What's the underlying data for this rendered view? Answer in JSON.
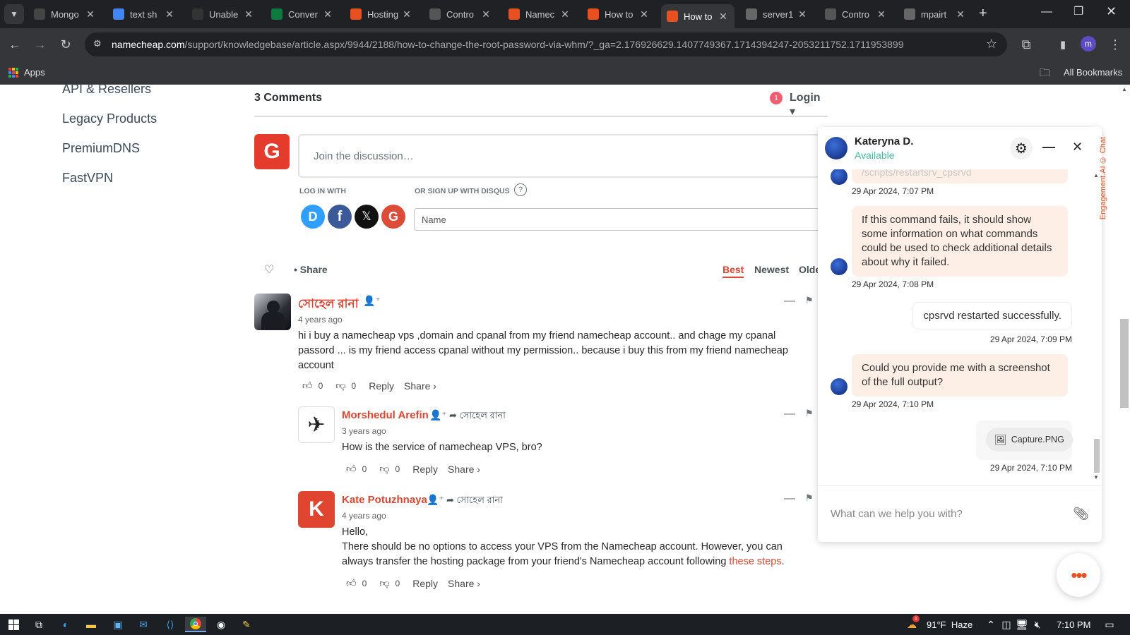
{
  "browser": {
    "tabs": [
      {
        "title": "Mongo",
        "icon": "openai-icon",
        "color": "#444"
      },
      {
        "title": "text sh",
        "icon": "docs-icon",
        "color": "#4285f4"
      },
      {
        "title": "Unable",
        "icon": "github-icon",
        "color": "#333"
      },
      {
        "title": "Conver",
        "icon": "mongodb-leaf-icon",
        "color": "#0d7a3e"
      },
      {
        "title": "Hosting",
        "icon": "namecheap-icon",
        "color": "#e8501f"
      },
      {
        "title": "Contro",
        "icon": "cpanel-icon",
        "color": "#555"
      },
      {
        "title": "Namec",
        "icon": "namecheap-icon",
        "color": "#e8501f"
      },
      {
        "title": "How to",
        "icon": "namecheap-icon",
        "color": "#e8501f"
      },
      {
        "title": "How to",
        "icon": "namecheap-icon",
        "color": "#e8501f",
        "active": true
      },
      {
        "title": "server1",
        "icon": "globe-icon",
        "color": "#666"
      },
      {
        "title": "Contro",
        "icon": "cpanel-icon",
        "color": "#555"
      },
      {
        "title": "mpairt",
        "icon": "globe-icon",
        "color": "#666"
      }
    ],
    "url_host": "namecheap.com",
    "url_path": "/support/knowledgebase/article.aspx/9944/2188/how-to-change-the-root-password-via-whm/?_ga=2.176926629.1407749367.1714394247-2053211752.1711953899",
    "bookmarks": {
      "apps_label": "Apps",
      "all_bookmarks_label": "All Bookmarks"
    },
    "profile_initial": "m"
  },
  "sidebar": {
    "links": [
      "API & Resellers",
      "Legacy Products",
      "PremiumDNS",
      "FastVPN"
    ]
  },
  "disqus": {
    "comments_count": "3 Comments",
    "notification_count": "1",
    "login_label": "Login",
    "user_avatar_letter": "G",
    "join_placeholder": "Join the discussion…",
    "log_in_with": "LOG IN WITH",
    "or_sign_up": "OR SIGN UP WITH DISQUS",
    "help_glyph": "?",
    "name_placeholder": "Name",
    "social": {
      "disqus": "D",
      "facebook": "f",
      "x": "𝕏",
      "google": "G"
    },
    "share_label": "Share",
    "sort": {
      "best": "Best",
      "newest": "Newest",
      "oldest": "Olde"
    },
    "comments": [
      {
        "author": "সোহেল রানা",
        "time": "4 years ago",
        "text": "hi i buy a namecheap vps ,domain and cpanal from my friend namecheap account.. and chage my cpanal passord ... is my friend access cpanal without my permission.. because i buy this from my friend namecheap account",
        "likes": "0",
        "dislikes": "0",
        "reply_label": "Reply",
        "share_label": "Share ›"
      },
      {
        "author": "Morshedul Arefin",
        "reply_to": "সোহেল রানা",
        "time": "3 years ago",
        "text": "How is the service of namecheap VPS, bro?",
        "likes": "0",
        "dislikes": "0",
        "reply_label": "Reply",
        "share_label": "Share ›"
      },
      {
        "author": "Kate Potuzhnaya",
        "avatar_letter": "K",
        "reply_to": "সোহেল রানা",
        "time": "4 years ago",
        "text_line1": "Hello,",
        "text_line2": "There should be no options to access your VPS from the Namecheap account. However, you can always transfer the hosting package from your friend's Namecheap account following ",
        "link_text": "these steps",
        "text_end": ".",
        "likes": "0",
        "dislikes": "0",
        "reply_label": "Reply",
        "share_label": "Share ›"
      }
    ]
  },
  "chat": {
    "agent_name": "Kateryna D.",
    "agent_status": "Available",
    "partial_message": "/scripts/restartsrv_cpsrvd",
    "messages": [
      {
        "from": "agent",
        "time": "29 Apr 2024, 7:07 PM"
      },
      {
        "from": "agent",
        "text": "If this command fails, it should show some information on what commands could be used to check additional details about why it failed.",
        "time": "29 Apr 2024, 7:08 PM"
      },
      {
        "from": "user",
        "text": "cpsrvd restarted successfully.",
        "time": "29 Apr 2024, 7:09 PM"
      },
      {
        "from": "agent",
        "text": "Could you provide me with a screenshot of the full output?",
        "time": "29 Apr 2024, 7:10 PM"
      },
      {
        "from": "user",
        "attachment": "Capture.PNG",
        "time": "29 Apr 2024, 7:10 PM"
      }
    ],
    "input_placeholder": "What can we help you with?",
    "side_label": "Engagement.AI © Chat",
    "accent": "#e8501f",
    "status_color": "#3cbf9e"
  },
  "taskbar": {
    "weather": "91°F  Haze",
    "weather_badge": "1",
    "time": "7:10 PM"
  }
}
